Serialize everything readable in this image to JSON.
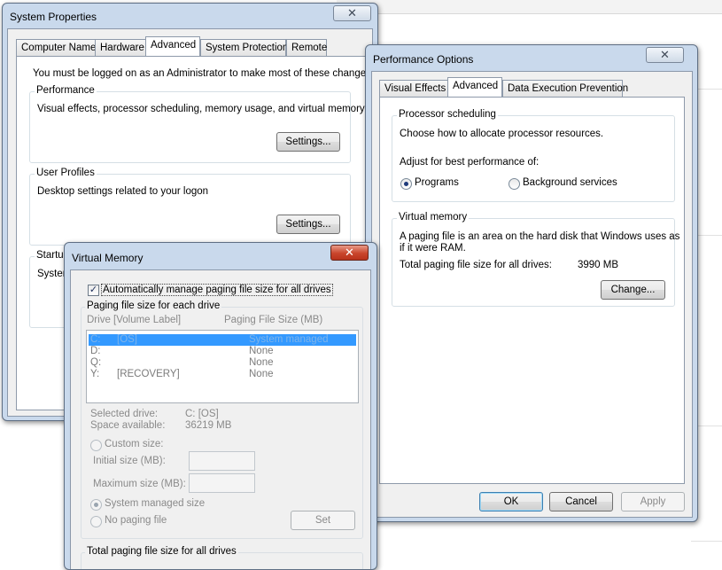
{
  "system_properties": {
    "title": "System Properties",
    "close": "✕",
    "tabs": [
      "Computer Name",
      "Hardware",
      "Advanced",
      "System Protection",
      "Remote"
    ],
    "admin_note": "You must be logged on as an Administrator to make most of these changes.",
    "performance": {
      "label": "Performance",
      "description": "Visual effects, processor scheduling, memory usage, and virtual memory",
      "button": "Settings..."
    },
    "user_profiles": {
      "label": "User Profiles",
      "description": "Desktop settings related to your logon",
      "button": "Settings..."
    },
    "startup": {
      "label": "Startup",
      "description": "System"
    }
  },
  "performance_options": {
    "title": "Performance Options",
    "close": "✕",
    "tabs": [
      "Visual Effects",
      "Advanced",
      "Data Execution Prevention"
    ],
    "processor_scheduling": {
      "label": "Processor scheduling",
      "description": "Choose how to allocate processor resources.",
      "adjust_label": "Adjust for best performance of:",
      "option_programs": "Programs",
      "option_background": "Background services"
    },
    "virtual_memory": {
      "label": "Virtual memory",
      "description_line1": "A paging file is an area on the hard disk that Windows uses as",
      "description_line2": "if it were RAM.",
      "total_label": "Total paging file size for all drives:",
      "total_value": "3990 MB",
      "change_button": "Change..."
    },
    "buttons": {
      "ok": "OK",
      "cancel": "Cancel",
      "apply": "Apply"
    }
  },
  "virtual_memory_dialog": {
    "title": "Virtual Memory",
    "close": "✕",
    "auto_manage_label": "Automatically manage paging file size for all drives",
    "auto_manage_checked": "✓",
    "paging_group_label": "Paging file size for each drive",
    "col_drive": "Drive  [Volume Label]",
    "col_size": "Paging File Size (MB)",
    "drives": [
      {
        "drive": "C:",
        "label": "[OS]",
        "size": "System managed"
      },
      {
        "drive": "D:",
        "label": "",
        "size": "None"
      },
      {
        "drive": "Q:",
        "label": "",
        "size": "None"
      },
      {
        "drive": "Y:",
        "label": "[RECOVERY]",
        "size": "None"
      }
    ],
    "selected_drive_label": "Selected drive:",
    "selected_drive_value": "C:  [OS]",
    "space_available_label": "Space available:",
    "space_available_value": "36219 MB",
    "custom_size": "Custom size:",
    "initial_size": "Initial size (MB):",
    "maximum_size": "Maximum size (MB):",
    "system_managed": "System managed size",
    "no_paging": "No paging file",
    "set_button": "Set",
    "total_group_label": "Total paging file size for all drives"
  }
}
